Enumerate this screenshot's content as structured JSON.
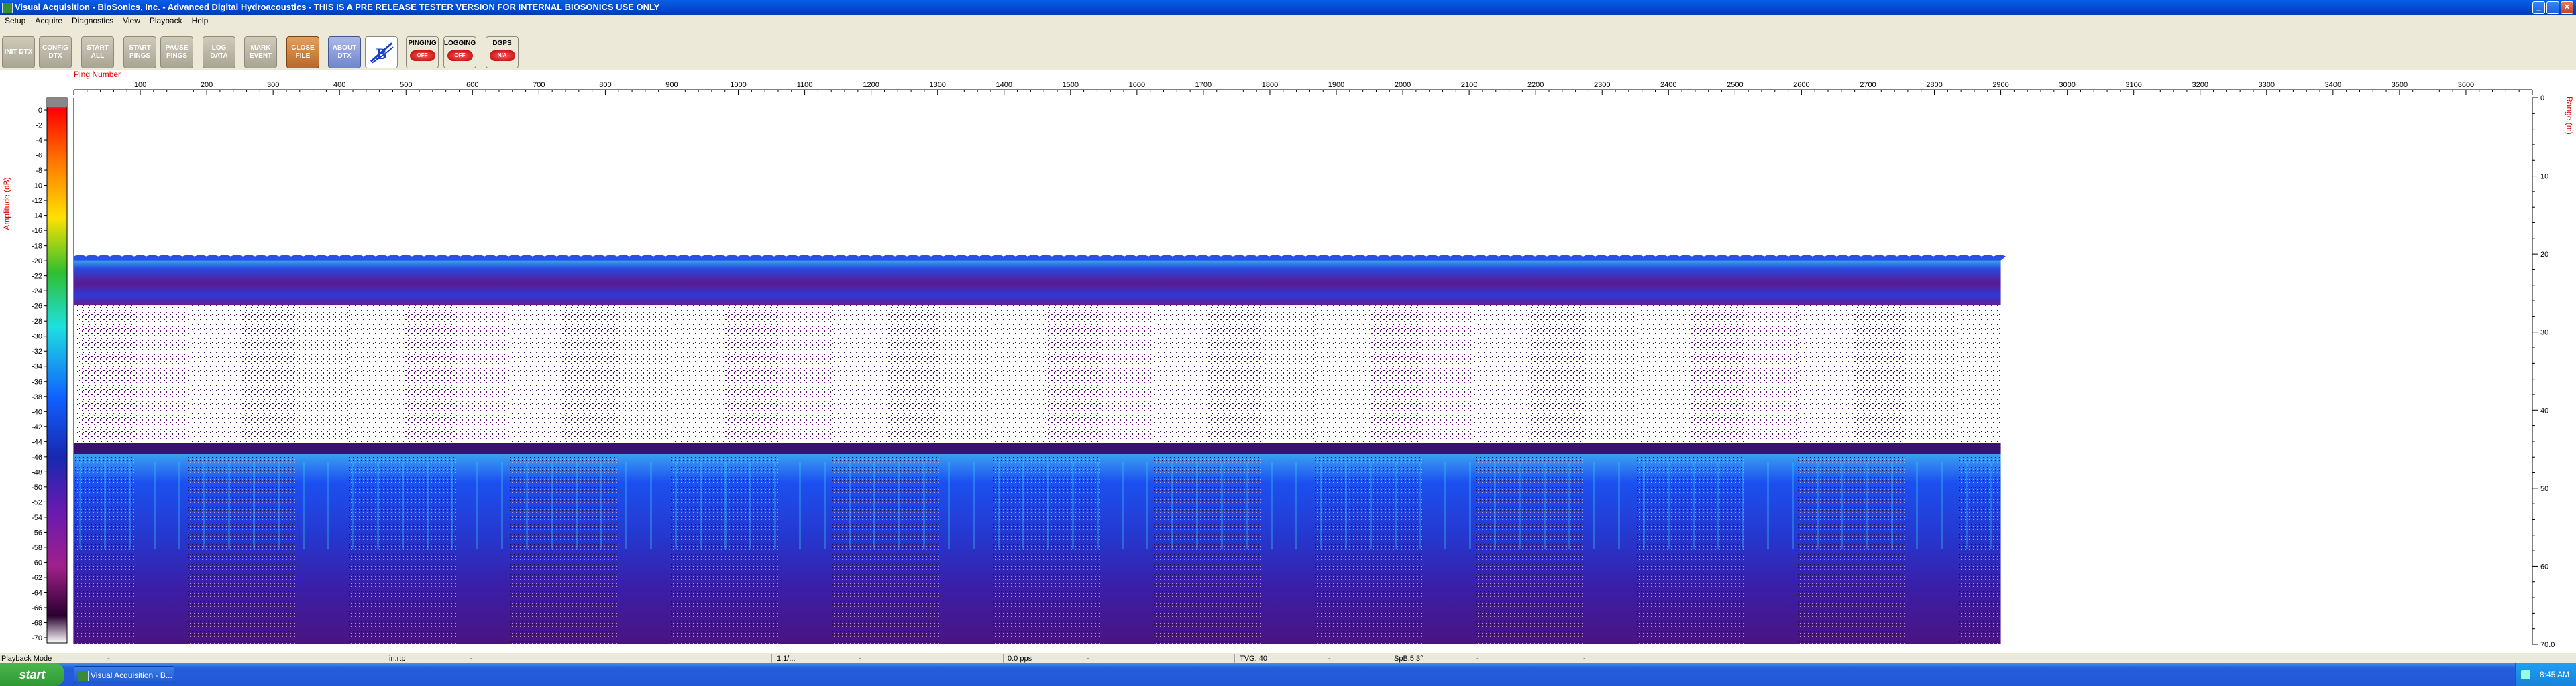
{
  "window": {
    "title": "Visual Acquisition  -  BioSonics, Inc.  -  Advanced Digital Hydroacoustics  -  THIS IS A PRE RELEASE TESTER VERSION FOR INTERNAL BIOSONICS USE ONLY",
    "minimize": "_",
    "maximize": "□",
    "close": "✕"
  },
  "menu": [
    "Setup",
    "Acquire",
    "Diagnostics",
    "View",
    "Playback",
    "Help"
  ],
  "toolbar": {
    "buttons": [
      {
        "label": "INIT DTX"
      },
      {
        "label": "CONFIG DTX"
      },
      {
        "label": "START ALL"
      },
      {
        "label": "START PINGS"
      },
      {
        "label": "PAUSE PINGS"
      },
      {
        "label": "LOG DATA"
      },
      {
        "label": "MARK EVENT"
      },
      {
        "label": "CLOSE FILE"
      },
      {
        "label": "ABOUT DTX"
      }
    ],
    "logo_text": "B",
    "indicators": [
      {
        "label": "PINGING",
        "state": "OFF"
      },
      {
        "label": "LOGGING",
        "state": "OFF"
      },
      {
        "label": "DGPS",
        "state": "N/A"
      }
    ]
  },
  "plot": {
    "x_axis_title": "Ping Number",
    "x_ticks": [
      100,
      200,
      300,
      400,
      500,
      600,
      700,
      800,
      900,
      1000,
      1100,
      1200,
      1300,
      1400,
      1500,
      1600,
      1700,
      1800,
      1900,
      2000,
      2100,
      2200,
      2300,
      2400,
      2500,
      2600,
      2700,
      2800,
      2900,
      3000,
      3100,
      3200,
      3300,
      3400,
      3500,
      3600
    ],
    "x_max": 3700,
    "data_last_ping": 2900,
    "colorbar_title": "Amplitude (dB)",
    "colorbar_ticks": [
      0,
      -2,
      -4,
      -6,
      -8,
      -10,
      -12,
      -14,
      -16,
      -18,
      -20,
      -22,
      -24,
      -26,
      -28,
      -30,
      -32,
      -34,
      -36,
      -38,
      -40,
      -42,
      -44,
      -46,
      -48,
      -50,
      -52,
      -54,
      -56,
      -58,
      -60,
      -62,
      -64,
      -66,
      -68,
      -70
    ],
    "range_title": "Range (m)",
    "range_ticks": [
      "0",
      "10",
      "20",
      "30",
      "40",
      "50",
      "60",
      "70.0"
    ],
    "range_max": 70,
    "colors": {
      "background": "#ffffff",
      "water": "#2a3fd8",
      "deep": "#4a1080",
      "noise": "#5a1070",
      "surface_cyan": "#2fd0e8",
      "text_red": "#e00000"
    }
  },
  "statusbar": {
    "mode": "Playback Mode",
    "dash1": "-",
    "file": "in.rtp",
    "dash2": "-",
    "speed": "1:1/...",
    "dash3": "-",
    "pps": "0.0 pps",
    "dash4": "-",
    "tvg": "TVG: 40",
    "dash5": "-",
    "sphi": "SpB:5.3°",
    "dash6": "-",
    "dash7": "-"
  },
  "taskbar": {
    "start": "start",
    "task_label": "Visual Acquisition - B...",
    "clock": "8:45 AM"
  }
}
